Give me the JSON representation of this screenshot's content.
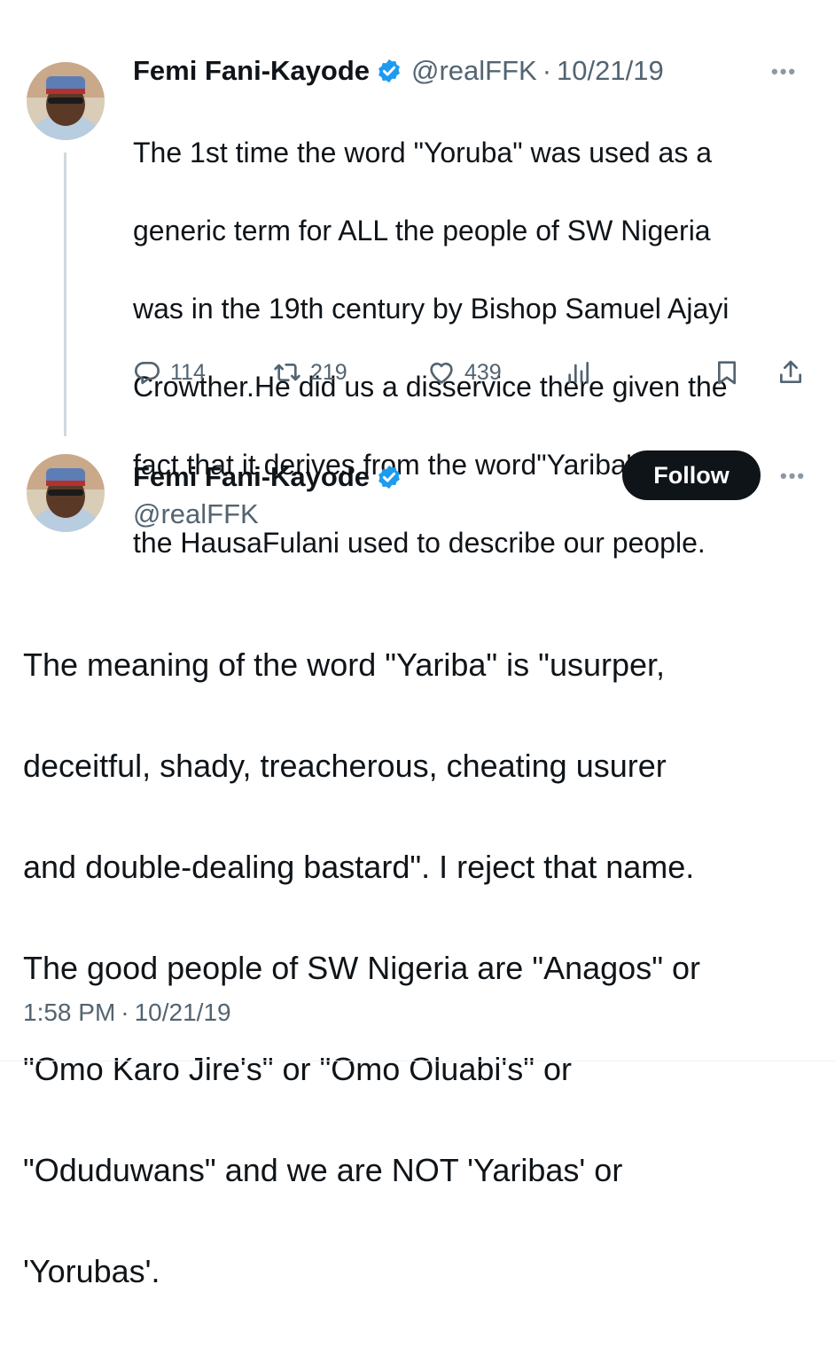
{
  "reply_tweet": {
    "author_name": "Femi Fani-Kayode",
    "handle": "@realFFK",
    "separator": "·",
    "date": "10/21/19",
    "more": "•••",
    "text_lines": [
      "The 1st time the word \"Yoruba\" was used as a",
      "generic term for ALL the people of SW Nigeria",
      "was in the 19th century by Bishop Samuel Ajayi",
      "Crowther.He did us a disservice there given the",
      "fact that it derives from the word\"Yariba\" which",
      "the HausaFulani used to describe our people."
    ],
    "replies": "114",
    "retweets": "219",
    "likes": "439"
  },
  "main_tweet": {
    "author_name": "Femi Fani-Kayode",
    "handle": "@realFFK",
    "follow_label": "Follow",
    "more": "•••",
    "text_lines": [
      "The meaning of the word \"Yariba\" is \"usurper,",
      "deceitful, shady, treacherous, cheating usurer",
      "and double-dealing bastard\". I reject that name.",
      "The good people of SW Nigeria are \"Anagos\" or",
      "\"Omo Karo Jire's\" or \"Omo Oluabi's\" or",
      "\"Oduduwans\" and we are NOT 'Yaribas' or",
      "'Yorubas'."
    ],
    "time": "1:58 PM",
    "separator": "·",
    "date": "10/21/19"
  },
  "colors": {
    "verified": "#1d9bf0",
    "secondary_text": "#536471",
    "follow_bg": "#0f1419"
  },
  "icons": [
    "verified-badge-icon",
    "reply-icon",
    "retweet-icon",
    "like-icon",
    "views-icon",
    "bookmark-icon",
    "share-icon",
    "more-icon"
  ]
}
